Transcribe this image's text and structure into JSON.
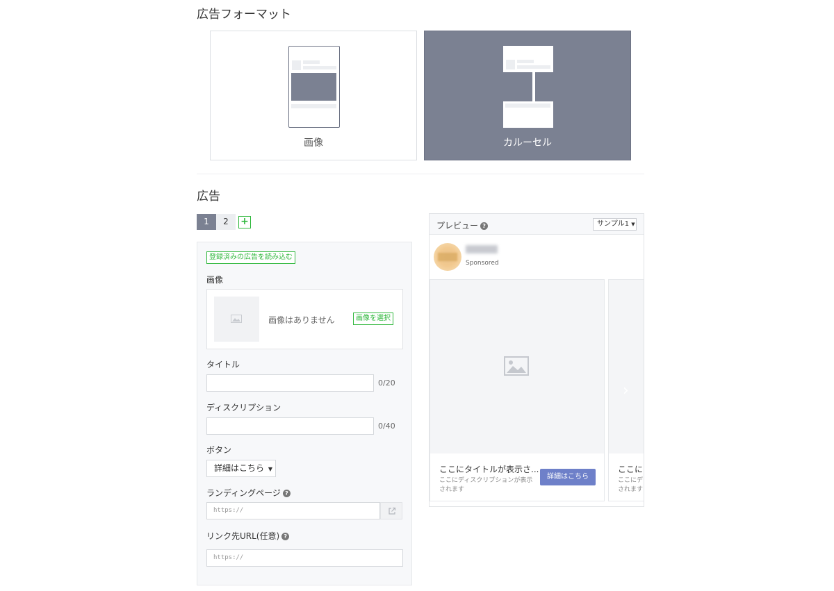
{
  "format_section": {
    "title": "広告フォーマット",
    "options": [
      {
        "label": "画像",
        "selected": false
      },
      {
        "label": "カルーセル",
        "selected": true
      }
    ]
  },
  "ads_section": {
    "title": "広告",
    "tabs": [
      "1",
      "2"
    ],
    "active_tab": "1",
    "add_label": "+"
  },
  "editor": {
    "load_button": "登録済みの広告を読み込む",
    "image_label": "画像",
    "no_image_text": "画像はありません",
    "select_image_button": "画像を選択",
    "title_label": "タイトル",
    "title_value": "",
    "title_counter": "0/20",
    "description_label": "ディスクリプション",
    "description_value": "",
    "description_counter": "0/40",
    "button_label": "ボタン",
    "button_value": "詳細はこちら",
    "landing_label": "ランディングページ",
    "landing_placeholder": "https://",
    "link_label": "リンク先URL(任意)",
    "link_placeholder": "https://"
  },
  "preview": {
    "title": "プレビュー",
    "sample_select": "サンプル1",
    "sponsored": "Sponsored",
    "cards": [
      {
        "title": "ここにタイトルが表示さ...",
        "description": "ここにディスクリプションが表示されます",
        "cta": "詳細はこちら"
      },
      {
        "title": "ここにタ",
        "description": "ここにデ されます"
      }
    ]
  },
  "colors": {
    "selected_card": "#7b8192",
    "green_accent": "#2eb73b",
    "cta_blue": "#6e80c9"
  },
  "icons": [
    "help-icon",
    "image-placeholder-icon",
    "external-link-icon",
    "chevron-right-icon",
    "plus-icon",
    "caret-down-icon"
  ]
}
